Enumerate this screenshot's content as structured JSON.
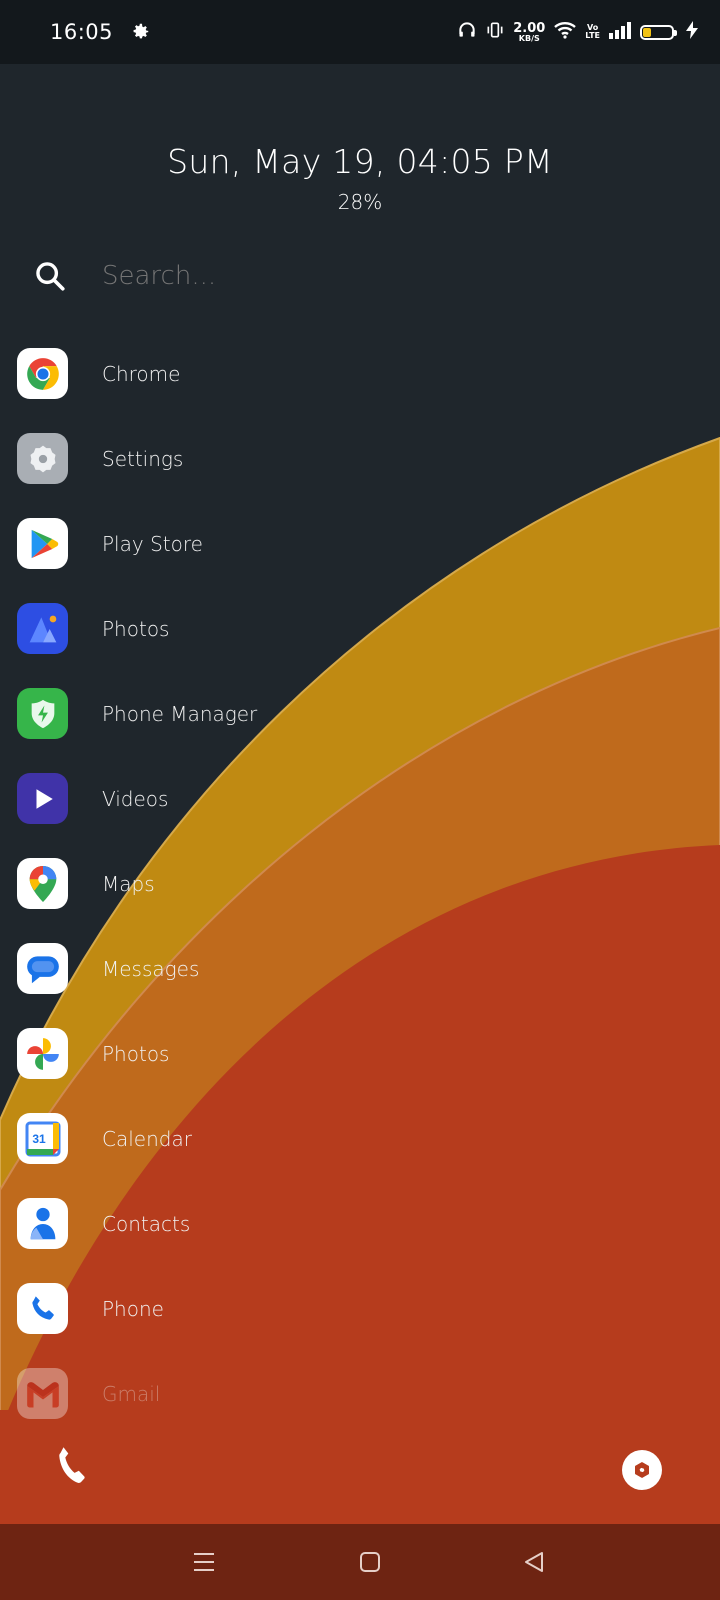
{
  "status_bar": {
    "time": "16:05",
    "net_speed_value": "2.00",
    "net_speed_unit": "KB/S",
    "volte_top": "Vo",
    "volte_bottom": "LTE",
    "battery_level": 0.28,
    "icons": [
      "settings-gear-icon",
      "headphones-icon",
      "vibrate-icon",
      "wifi-icon",
      "signal-icon",
      "battery-icon",
      "charging-icon"
    ]
  },
  "header": {
    "datetime": "Sun, May 19, 04:05 PM",
    "battery_percent": "28%"
  },
  "search": {
    "placeholder": "Search..."
  },
  "apps": [
    {
      "label": "Chrome",
      "icon": "chrome-icon"
    },
    {
      "label": "Settings",
      "icon": "settings-icon"
    },
    {
      "label": "Play Store",
      "icon": "play-store-icon"
    },
    {
      "label": "Photos",
      "icon": "photos-gallery-icon"
    },
    {
      "label": "Phone Manager",
      "icon": "phone-manager-icon"
    },
    {
      "label": "Videos",
      "icon": "videos-icon"
    },
    {
      "label": "Maps",
      "icon": "maps-icon"
    },
    {
      "label": "Messages",
      "icon": "messages-icon"
    },
    {
      "label": "Photos",
      "icon": "google-photos-icon"
    },
    {
      "label": "Calendar",
      "icon": "calendar-icon",
      "badge": "31"
    },
    {
      "label": "Contacts",
      "icon": "contacts-icon"
    },
    {
      "label": "Phone",
      "icon": "phone-icon"
    },
    {
      "label": "Gmail",
      "icon": "gmail-icon"
    }
  ],
  "dock": {
    "left": "phone-icon",
    "right": "camera-aperture-icon"
  },
  "nav": [
    "menu-icon",
    "home-icon",
    "back-icon"
  ],
  "colors": {
    "background": "#1f262c",
    "wave_yellow": "#c08a12",
    "wave_orange": "#bf6a1c",
    "wave_red": "#b63c1d",
    "navbar": "#6e2412"
  }
}
